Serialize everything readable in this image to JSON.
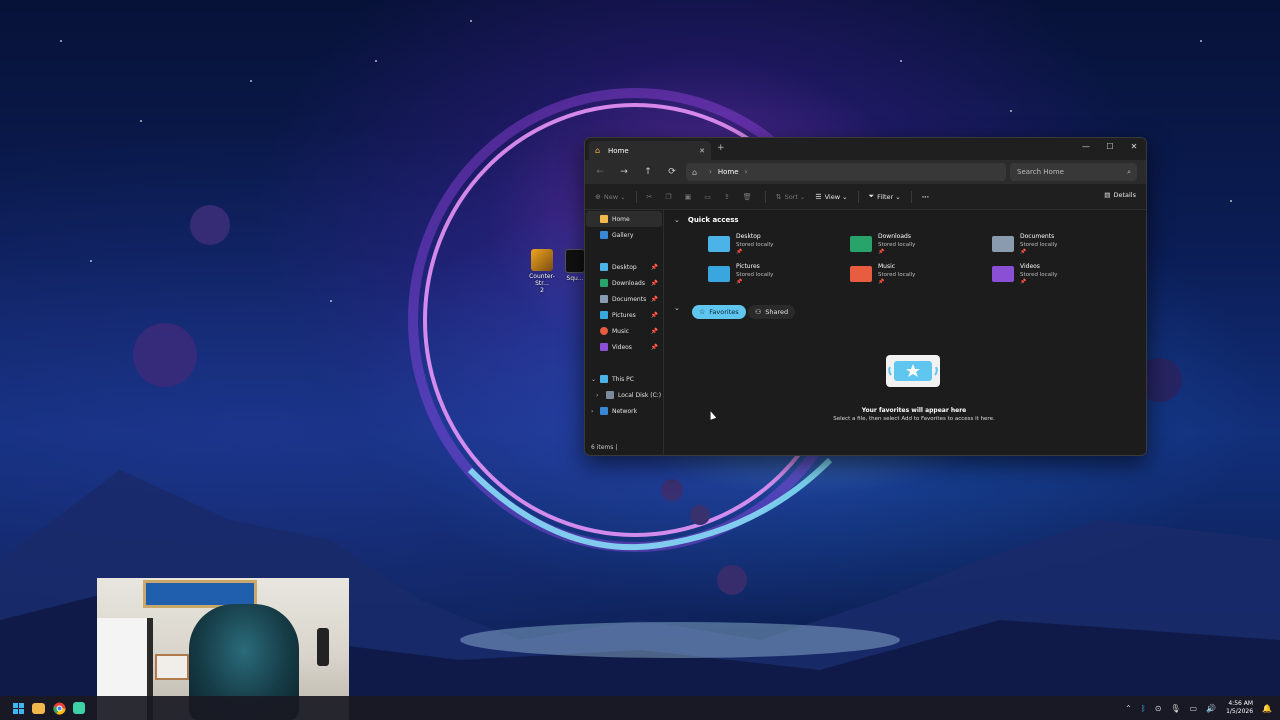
{
  "desktop": {
    "icons": [
      {
        "label": "Counter-Str...\n2"
      },
      {
        "label": "Squ..."
      }
    ]
  },
  "explorer": {
    "tab_title": "Home",
    "tab_close": "✕",
    "new_tab": "+",
    "window_controls": {
      "minimize": "—",
      "maximize": "☐",
      "close": "✕"
    },
    "breadcrumb": [
      "Home"
    ],
    "search_placeholder": "Search Home",
    "toolbar": {
      "new": "New",
      "sort": "Sort",
      "view": "View",
      "filter": "Filter",
      "more": "···",
      "details": "Details"
    },
    "sidebar": {
      "top": [
        {
          "label": "Home",
          "icon": "home-icon",
          "color": "#f2b84b"
        },
        {
          "label": "Gallery",
          "icon": "gallery-icon",
          "color": "#3a86d6"
        }
      ],
      "pinned": [
        {
          "label": "Desktop",
          "icon": "desktop-folder-icon",
          "color": "#4cb3e8"
        },
        {
          "label": "Downloads",
          "icon": "downloads-folder-icon",
          "color": "#28a36a"
        },
        {
          "label": "Documents",
          "icon": "documents-folder-icon",
          "color": "#8a9bb0"
        },
        {
          "label": "Pictures",
          "icon": "pictures-folder-icon",
          "color": "#3aa6e0"
        },
        {
          "label": "Music",
          "icon": "music-folder-icon",
          "color": "#e85d3f"
        },
        {
          "label": "Videos",
          "icon": "videos-folder-icon",
          "color": "#8b4fd6"
        }
      ],
      "tree": [
        {
          "label": "This PC",
          "icon": "pc-icon",
          "expanded": true
        },
        {
          "label": "Local Disk (C:)",
          "icon": "drive-icon",
          "expanded": false
        },
        {
          "label": "Network",
          "icon": "network-icon",
          "expanded": false
        }
      ]
    },
    "quick_access": {
      "title": "Quick access",
      "items": [
        {
          "name": "Desktop",
          "sub": "Stored locally",
          "color": "#4cb3e8"
        },
        {
          "name": "Downloads",
          "sub": "Stored locally",
          "color": "#28a36a"
        },
        {
          "name": "Documents",
          "sub": "Stored locally",
          "color": "#8a9bb0"
        },
        {
          "name": "Pictures",
          "sub": "Stored locally",
          "color": "#3aa6e0"
        },
        {
          "name": "Music",
          "sub": "Stored locally",
          "color": "#e85d3f"
        },
        {
          "name": "Videos",
          "sub": "Stored locally",
          "color": "#8b4fd6"
        }
      ]
    },
    "favorites_tabs": {
      "favorites": "Favorites",
      "shared": "Shared"
    },
    "empty_state": {
      "title": "Your favorites will appear here",
      "subtitle": "Select a file, then select Add to Favorites to access it here."
    },
    "status": "6 items  |"
  },
  "taskbar": {
    "clock_time": "4:56 AM",
    "clock_date": "1/5/2026"
  },
  "colors": {
    "accent": "#5fc6ef",
    "window_bg": "#1c1c1c"
  }
}
